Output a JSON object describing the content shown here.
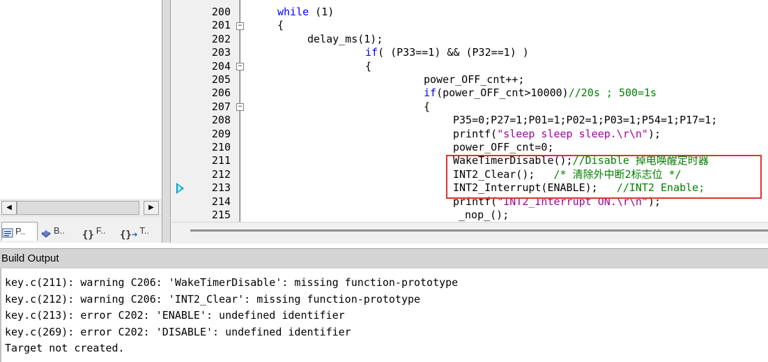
{
  "project_pane": {
    "tabs": [
      {
        "label": "P..",
        "icon": "project-icon"
      },
      {
        "label": "B..",
        "icon": "books-icon"
      },
      {
        "label": "F..",
        "icon": "functions-icon"
      },
      {
        "label": "T..",
        "icon": "templates-icon"
      }
    ],
    "scroll_left": "◀",
    "scroll_right": "▶"
  },
  "editor": {
    "line_numbers": [
      "200",
      "201",
      "202",
      "203",
      "204",
      "205",
      "206",
      "207",
      "208",
      "209",
      "210",
      "211",
      "212",
      "213",
      "214",
      "215"
    ],
    "fold_minus": "−",
    "code": {
      "l200_kw": "while",
      "l200_rest": " (1)",
      "l201": "{",
      "l202": "delay_ms(1);",
      "l203_kw": "if",
      "l203_rest": "( (P33==1) && (P32==1) )",
      "l204": "{",
      "l205": "power_OFF_cnt++;",
      "l206_kw": "if",
      "l206_rest": "(power_OFF_cnt>10000)",
      "l206_cm": "//20s ; 500=1s",
      "l207": "{",
      "l208": "P35=0;P27=1;P01=1;P02=1;P03=1;P54=1;P17=1;",
      "l209_a": "printf(",
      "l209_str": "\"sleep sleep sleep.\\r\\n\"",
      "l209_b": ");",
      "l210": "power_OFF_cnt=0;",
      "l211_a": "WakeTimerDisable();",
      "l211_cm": "//Disable 掉电唤醒定时器",
      "l212_a": "INT2_Clear();   ",
      "l212_cm": "/* 清除外中断2标志位 */",
      "l213_a": "INT2_Interrupt(ENABLE);   ",
      "l213_cm": "//INT2 Enable;",
      "l214_a": "printf(",
      "l214_str": "\"INT2_Interrupt ON.\\r\\n\"",
      "l214_b": ");",
      "l215": "_nop_();"
    }
  },
  "build_output": {
    "title": "Build Output",
    "lines": [
      "key.c(211): warning C206: 'WakeTimerDisable': missing function-prototype",
      "key.c(212): warning C206: 'INT2_Clear': missing function-prototype",
      "key.c(213): error C202: 'ENABLE': undefined identifier",
      "key.c(269): error C202: 'DISABLE': undefined identifier",
      "Target not created."
    ]
  },
  "colors": {
    "keyword": "#0000ff",
    "comment": "#008000",
    "number": "#ff00ff",
    "highlight_box": "#e03030",
    "current_line_arrow": "#00a0c8"
  }
}
